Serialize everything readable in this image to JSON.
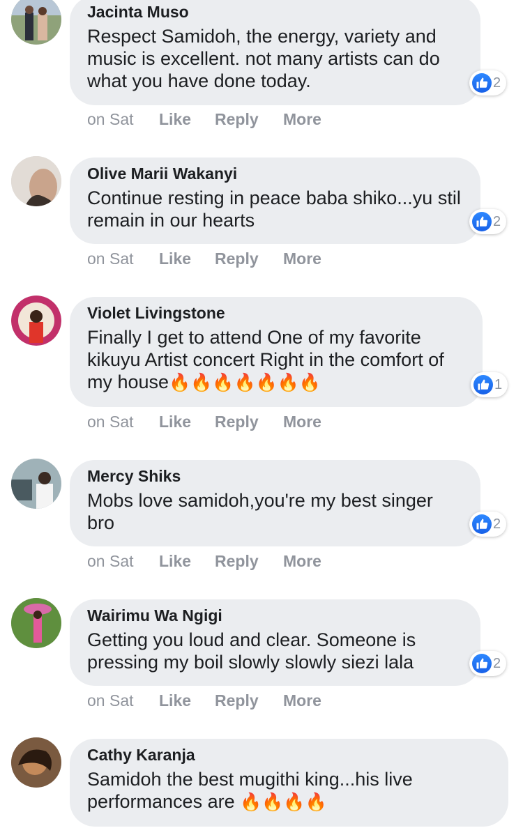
{
  "comments": [
    {
      "author": "Jacinta Muso",
      "text": "Respect Samidoh, the energy, variety and music is excellent. not many artists can do what you have done today.",
      "fires": "",
      "reaction_count": "2",
      "time": "on Sat",
      "like_label": "Like",
      "reply_label": "Reply",
      "more_label": "More"
    },
    {
      "author": "Olive Marii Wakanyi",
      "text": "Continue resting in peace baba shiko...yu stil remain in our hearts",
      "fires": "",
      "reaction_count": "2",
      "time": "on Sat",
      "like_label": "Like",
      "reply_label": "Reply",
      "more_label": "More"
    },
    {
      "author": "Violet Livingstone",
      "text": "Finally I get to attend One of my favorite kikuyu Artist concert Right in the comfort of my house",
      "fires": "🔥🔥🔥🔥🔥🔥🔥",
      "reaction_count": "1",
      "time": "on Sat",
      "like_label": "Like",
      "reply_label": "Reply",
      "more_label": "More"
    },
    {
      "author": "Mercy Shiks",
      "text": "Mobs love samidoh,you're my best singer bro",
      "fires": "",
      "reaction_count": "2",
      "time": "on Sat",
      "like_label": "Like",
      "reply_label": "Reply",
      "more_label": "More"
    },
    {
      "author": "Wairimu Wa Ngigi",
      "text": "Getting you loud and clear. Someone is pressing my boil slowly slowly siezi lala",
      "fires": "",
      "reaction_count": "2",
      "time": "on Sat",
      "like_label": "Like",
      "reply_label": "Reply",
      "more_label": "More"
    },
    {
      "author": "Cathy Karanja",
      "text": "Samidoh the best mugithi king...his live performances are ",
      "fires": "🔥🔥🔥🔥"
    }
  ],
  "icons": {
    "like_reaction": "thumbs-up-icon",
    "fire": "fire-emoji"
  },
  "colors": {
    "bubble": "#ebedf0",
    "like_blue": "#1877f2",
    "meta_gray": "#90949c"
  }
}
